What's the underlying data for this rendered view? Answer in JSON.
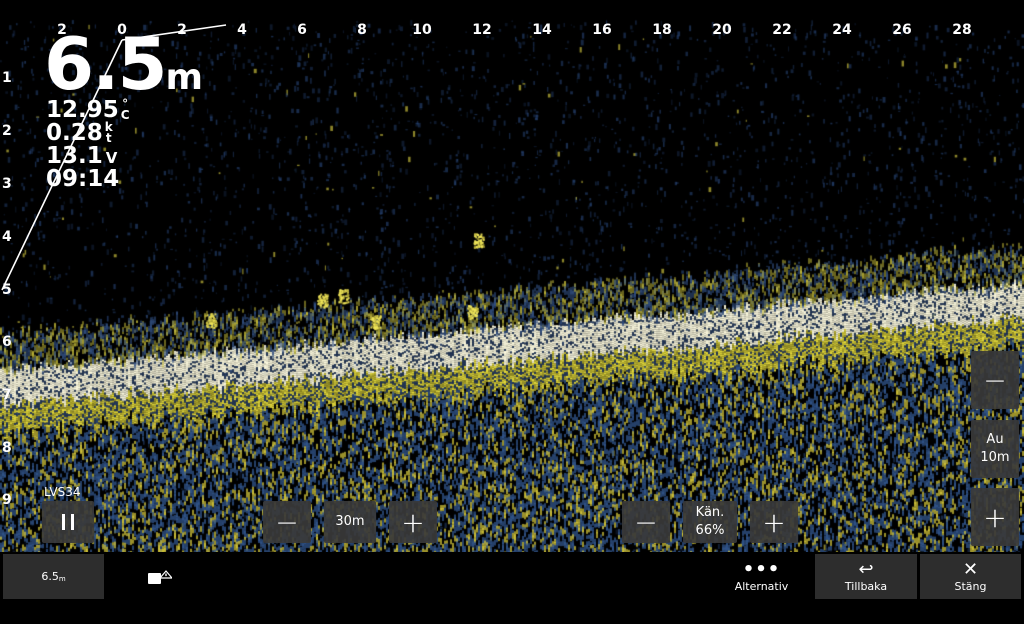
{
  "scale": {
    "horizontal": [
      "2",
      "0",
      "2",
      "4",
      "6",
      "8",
      "10",
      "12",
      "14",
      "16",
      "18",
      "20",
      "22",
      "24",
      "26",
      "28"
    ],
    "vertical": [
      "1",
      "2",
      "3",
      "4",
      "5",
      "6",
      "7",
      "8",
      "9"
    ]
  },
  "readouts": {
    "depth_value": "6.5",
    "depth_unit": "m",
    "temperature": "12.95",
    "temperature_unit_top": "°",
    "temperature_unit_bottom": "C",
    "speed": "0.28",
    "speed_unit_top": "k",
    "speed_unit_bottom": "t",
    "voltage": "13.1",
    "voltage_unit": "V",
    "time": "09:14"
  },
  "channel": {
    "name": "LVS34"
  },
  "controls": {
    "pause_icon": "pause-icon",
    "range_minus": "−",
    "range_value": "30m",
    "range_plus": "+",
    "gain_minus": "−",
    "gain_label": "Kän.",
    "gain_value": "66%",
    "gain_plus": "+",
    "zoom_minus": "−",
    "zoom_mode": "Au",
    "zoom_value": "10m",
    "zoom_plus": "+"
  },
  "bottom_bar": {
    "depth_value": "6.5",
    "depth_unit": "m",
    "options_label": "Alternativ",
    "back_label": "Tillbaka",
    "close_label": "Stäng"
  },
  "colors": {
    "echo_strong": "#fffbe0",
    "echo_mid": "#e8e040",
    "echo_weak": "#3e5b8a",
    "background": "#000000"
  }
}
